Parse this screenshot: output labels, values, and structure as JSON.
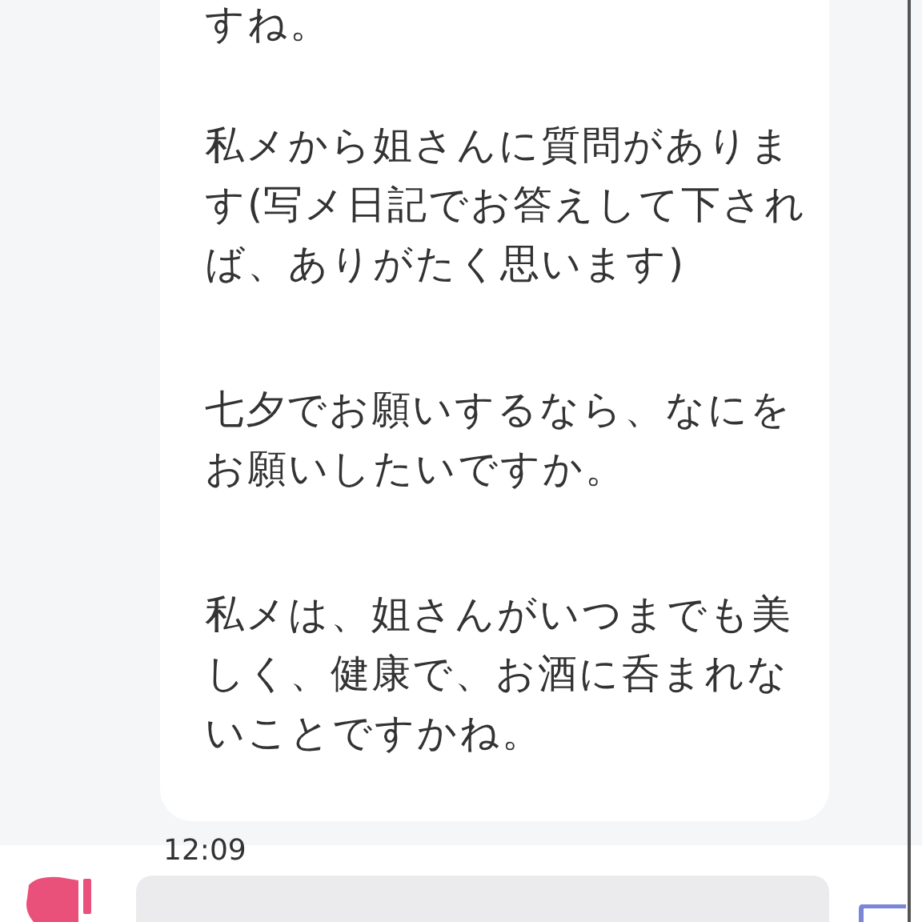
{
  "message": {
    "paragraphs": [
      [
        "すね。"
      ],
      [
        "私メから姐さんに質問がありま",
        "す(写メ日記でお答えして下され",
        "ば、ありがたく思います)"
      ],
      [
        "七夕でお願いするなら、なにを",
        "お願いしたいですか。"
      ],
      [
        "私メは、姐さんがいつまでも美",
        "しく、健康で、お酒に呑まれな",
        "いことですかね。"
      ]
    ]
  },
  "timestamp": "12:09"
}
